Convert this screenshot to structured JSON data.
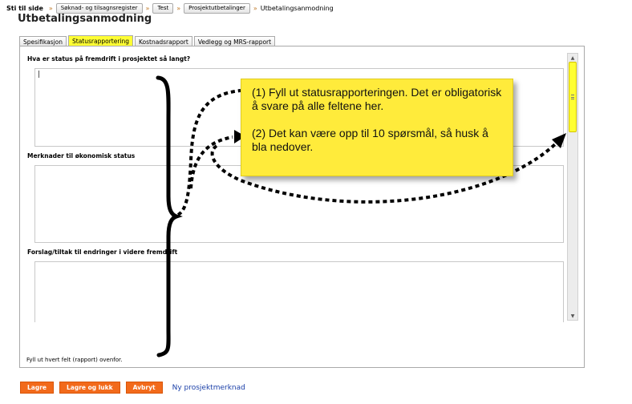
{
  "breadcrumb": {
    "lead": "Sti til side",
    "separator": "»",
    "items": [
      "Søknad- og tilsagnsregister",
      "Test",
      "Prosjektutbetalinger"
    ],
    "current": "Utbetalingsanmodning"
  },
  "page": {
    "title": "Utbetalingsanmodning"
  },
  "tabs": [
    {
      "label": "Spesifikasjon",
      "active": false
    },
    {
      "label": "Statusrapportering",
      "active": true
    },
    {
      "label": "Kostnadsrapport",
      "active": false
    },
    {
      "label": "Vedlegg og MRS-rapport",
      "active": false
    }
  ],
  "form": {
    "questions": [
      {
        "label": "Hva er status på fremdrift i prosjektet så langt?",
        "value": ""
      },
      {
        "label": "Merknader til økonomisk status",
        "value": ""
      },
      {
        "label": "Forslag/tiltak til endringer i videre fremdrift",
        "value": ""
      }
    ],
    "footer_note": "Fyll ut hvert felt (rapport) ovenfor."
  },
  "callout": {
    "line1": "(1) Fyll ut statusrapporteringen. Det er obligatorisk å svare på alle feltene her.",
    "line2": "(2) Det kan være opp til 10 spørsmål, så husk å bla nedover."
  },
  "actions": {
    "save": "Lagre",
    "save_close": "Lagre og lukk",
    "cancel": "Avbryt",
    "new_note": "Ny prosjektmerknad"
  },
  "colors": {
    "accent_yellow": "#ffff33",
    "callout_yellow": "#ffeb3b",
    "button_orange": "#f26a1b",
    "link_blue": "#1a3fa8"
  },
  "icons": {
    "scroll_up": "arrow-up-icon",
    "scroll_down": "arrow-down-icon"
  }
}
